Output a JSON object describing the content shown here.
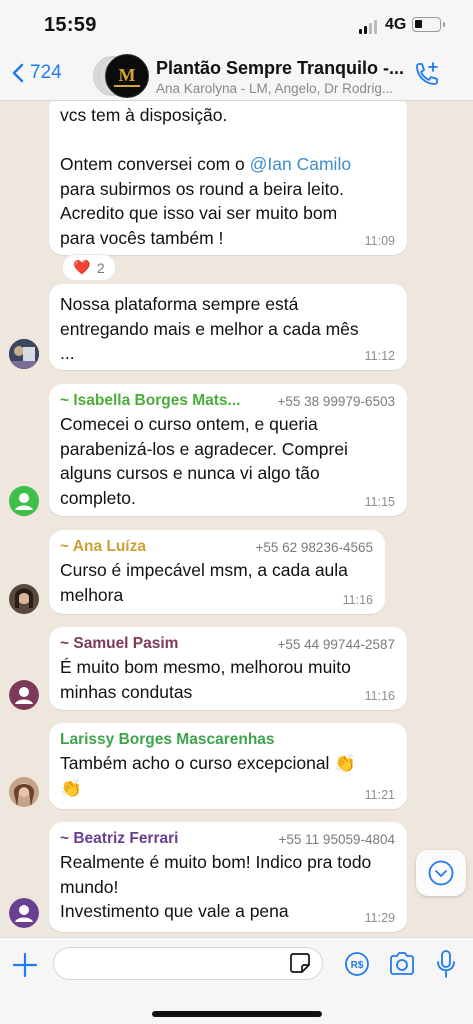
{
  "status": {
    "time": "15:59",
    "network": "4G",
    "battery_level": 0.25
  },
  "header": {
    "back_count": "724",
    "logo_text": "M",
    "title": "Plantão Sempre Tranquilo -...",
    "members": "Ana Karolyna - LM, Angelo, Dr Rodrig..."
  },
  "colors": {
    "accent": "#1f7bf0",
    "chat_bg": "#efe7dd",
    "bubble": "#ffffff",
    "mention": "#3d8ec9"
  },
  "messages": [
    {
      "text_before": "vcs tem à disposição.\n\nOntem conversei com o ",
      "mention": "@Ian Camilo",
      "text_after": "\npara subirmos os round a beira leito.\nAcredito que isso vai ser muito bom\npara vocês também !",
      "time": "11:09",
      "reaction": {
        "emoji": "❤️",
        "count": "2"
      }
    },
    {
      "text": "Nossa plataforma sempre está\nentregando mais e melhor a cada mês\n...",
      "time": "11:12"
    },
    {
      "sender": "~ Isabella Borges Mats...",
      "phone": "+55 38 99979-6503",
      "sender_color": "#4cae3a",
      "text": "Comecei o curso ontem, e queria\nparabenizá-los e agradecer. Comprei\nalguns cursos e nunca vi algo tão\ncompleto.",
      "time": "11:15"
    },
    {
      "sender": "~ Ana Luíza",
      "phone": "+55 62 98236-4565",
      "sender_color": "#c9a033",
      "text": "Curso é impecável msm, a cada aula\nmelhora",
      "time": "11:16"
    },
    {
      "sender": "~ Samuel Pasim",
      "phone": "+55 44 99744-2587",
      "sender_color": "#7d3a5a",
      "text": "É muito bom mesmo, melhorou muito\nminhas condutas",
      "time": "11:16"
    },
    {
      "sender": "Larissy Borges Mascarenhas",
      "sender_color": "#3fa34d",
      "text": "Também acho o curso excepcional 👏\n👏",
      "time": "11:21"
    },
    {
      "sender": "~ Beatriz Ferrari",
      "phone": "+55 11 95059-4804",
      "sender_color": "#6a3f8f",
      "text": "Realmente é muito bom! Indico pra todo\nmundo!\nInvestimento que vale a pena",
      "time": "11:29"
    }
  ],
  "input": {
    "placeholder": "",
    "value": ""
  }
}
